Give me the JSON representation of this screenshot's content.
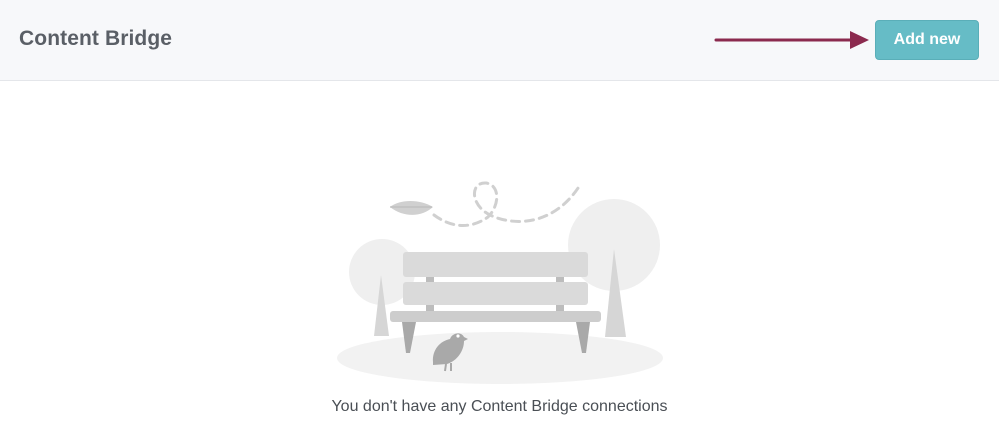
{
  "header": {
    "title": "Content Bridge",
    "add_button_label": "Add new",
    "accent_color": "#66bcc6",
    "annotation_arrow_color": "#8b2a4e"
  },
  "empty_state": {
    "illustration": "park-bench-with-bird-and-leaf",
    "message": "You don't have any Content Bridge connections"
  }
}
